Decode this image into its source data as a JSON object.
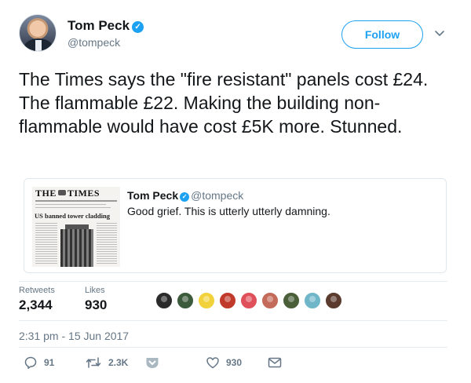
{
  "author": {
    "name": "Tom Peck",
    "handle": "@tompeck",
    "verified_mark": "✓"
  },
  "follow_label": "Follow",
  "tweet_text": "The Times says the \"fire resistant\" panels cost £24. The flammable £22. Making the building non-flammable would have cost £5K more. Stunned.",
  "quoted_tweet": {
    "thumbnail": {
      "masthead_left": "THE",
      "masthead_right": "TIMES",
      "headline": "US banned tower cladding"
    },
    "name": "Tom Peck",
    "handle": "@tompeck",
    "verified_mark": "✓",
    "text": "Good grief. This is utterly utterly damning."
  },
  "stats": {
    "retweets_label": "Retweets",
    "retweets_value": "2,344",
    "likes_label": "Likes",
    "likes_value": "930"
  },
  "likers": [
    {
      "icon": "avatar-1",
      "color": "#2b2b2b"
    },
    {
      "icon": "avatar-2",
      "color": "#3c5a3c"
    },
    {
      "icon": "avatar-3",
      "color": "#f2d23c"
    },
    {
      "icon": "avatar-4",
      "color": "#c0392b"
    },
    {
      "icon": "avatar-5",
      "color": "#e0505a"
    },
    {
      "icon": "avatar-6",
      "color": "#c46a5a"
    },
    {
      "icon": "avatar-7",
      "color": "#4a5e3a"
    },
    {
      "icon": "avatar-8",
      "color": "#6fb6c8"
    },
    {
      "icon": "avatar-9",
      "color": "#5a3b2e"
    }
  ],
  "timestamp": "2:31 pm - 15 Jun 2017",
  "actions": {
    "reply_count": "91",
    "retweet_count": "2.3K",
    "like_count": "930"
  },
  "colors": {
    "accent": "#1da1f2",
    "muted": "#657786",
    "text": "#14171a",
    "border": "#e1e8ed"
  },
  "icons": [
    "verified-icon",
    "chevron-down-icon",
    "reply-icon",
    "retweet-icon",
    "heart-icon",
    "envelope-icon"
  ]
}
